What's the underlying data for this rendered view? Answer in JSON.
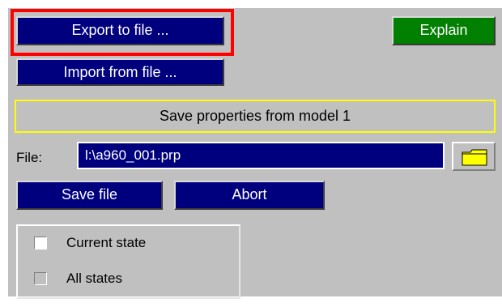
{
  "toolbar": {
    "export_label": "Export to file ...",
    "import_label": "Import from file ...",
    "explain_label": "Explain"
  },
  "title": {
    "text": "Save properties from model 1"
  },
  "file": {
    "label": "File:",
    "value": "l:\\a960_001.prp"
  },
  "actions": {
    "save_label": "Save file",
    "abort_label": "Abort"
  },
  "states": {
    "current_label": "Current state",
    "all_label": "All states"
  },
  "colors": {
    "panel_bg": "#c0c0c0",
    "button_navy": "#00007f",
    "button_green": "#007f00",
    "highlight_red": "#ff0000",
    "title_border_yellow": "#ffff00"
  },
  "icons": {
    "folder": "folder-icon"
  }
}
